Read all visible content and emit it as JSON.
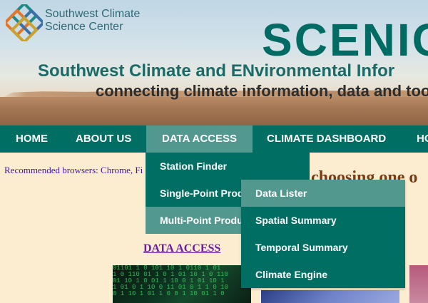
{
  "header": {
    "org_line1": "Southwest Climate",
    "org_line2": "Science Center",
    "title": "SCENIC",
    "subtitle": "Southwest Climate and ENvironmental Infor",
    "tagline": "connecting climate information, data and tools"
  },
  "nav": {
    "items": [
      "HOME",
      "ABOUT US",
      "DATA ACCESS",
      "CLIMATE DASHBOARD",
      "HO"
    ],
    "active": "DATA ACCESS"
  },
  "dropdown": {
    "items": [
      "Station Finder",
      "Single-Point Produ",
      "Multi-Point Produc"
    ],
    "highlighted": "Multi-Point Produc"
  },
  "submenu": {
    "items": [
      "Data Lister",
      "Spatial Summary",
      "Temporal Summary",
      "Climate Engine"
    ],
    "highlighted": "Data Lister"
  },
  "main": {
    "browsers_note": "Recommended browsers: Chrome, Fi",
    "choose_text": "choosing one o",
    "section_link": "DATA ACCESS"
  },
  "colors": {
    "nav_bg": "#006e63",
    "nav_active": "#52988f",
    "page_bg": "#fcedd0",
    "title": "#006b63"
  }
}
